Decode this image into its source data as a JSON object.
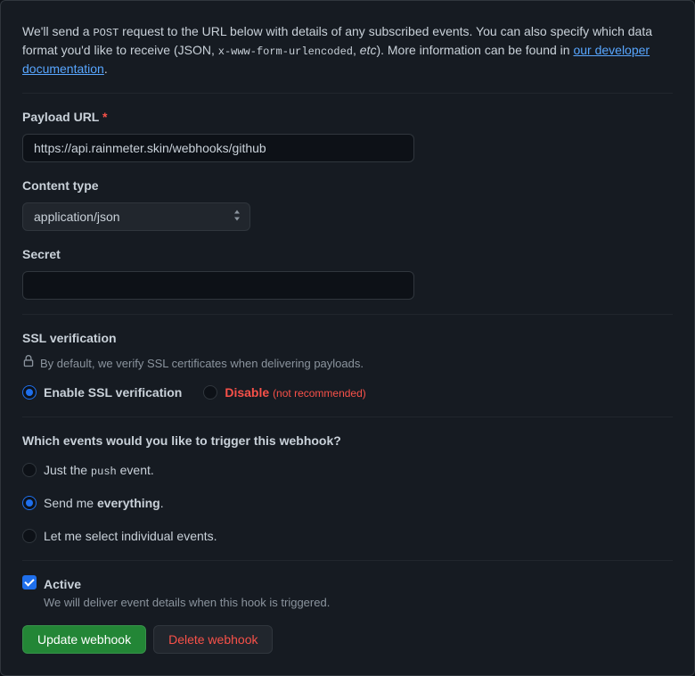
{
  "intro": {
    "prefix": "We'll send a ",
    "code1": "POST",
    "mid1": " request to the URL below with details of any subscribed events. You can also specify which data format you'd like to receive (JSON, ",
    "code2": "x-www-form-urlencoded",
    "mid2": ", ",
    "etc": "etc",
    "mid3": "). More information can be found in ",
    "link": "our developer documentation",
    "suffix": "."
  },
  "payload": {
    "label": "Payload URL",
    "value": "https://api.rainmeter.skin/webhooks/github"
  },
  "content_type": {
    "label": "Content type",
    "selected": "application/json"
  },
  "secret": {
    "label": "Secret",
    "value": ""
  },
  "ssl": {
    "heading": "SSL verification",
    "note": "By default, we verify SSL certificates when delivering payloads.",
    "enable": "Enable SSL verification",
    "disable": "Disable",
    "not_recommended": "(not recommended)"
  },
  "events": {
    "heading": "Which events would you like to trigger this webhook?",
    "just_prefix": "Just the ",
    "just_code": "push",
    "just_suffix": " event.",
    "everything_prefix": "Send me ",
    "everything_strong": "everything",
    "everything_suffix": ".",
    "individual": "Let me select individual events."
  },
  "active": {
    "label": "Active",
    "desc": "We will deliver event details when this hook is triggered."
  },
  "buttons": {
    "update": "Update webhook",
    "delete": "Delete webhook"
  }
}
